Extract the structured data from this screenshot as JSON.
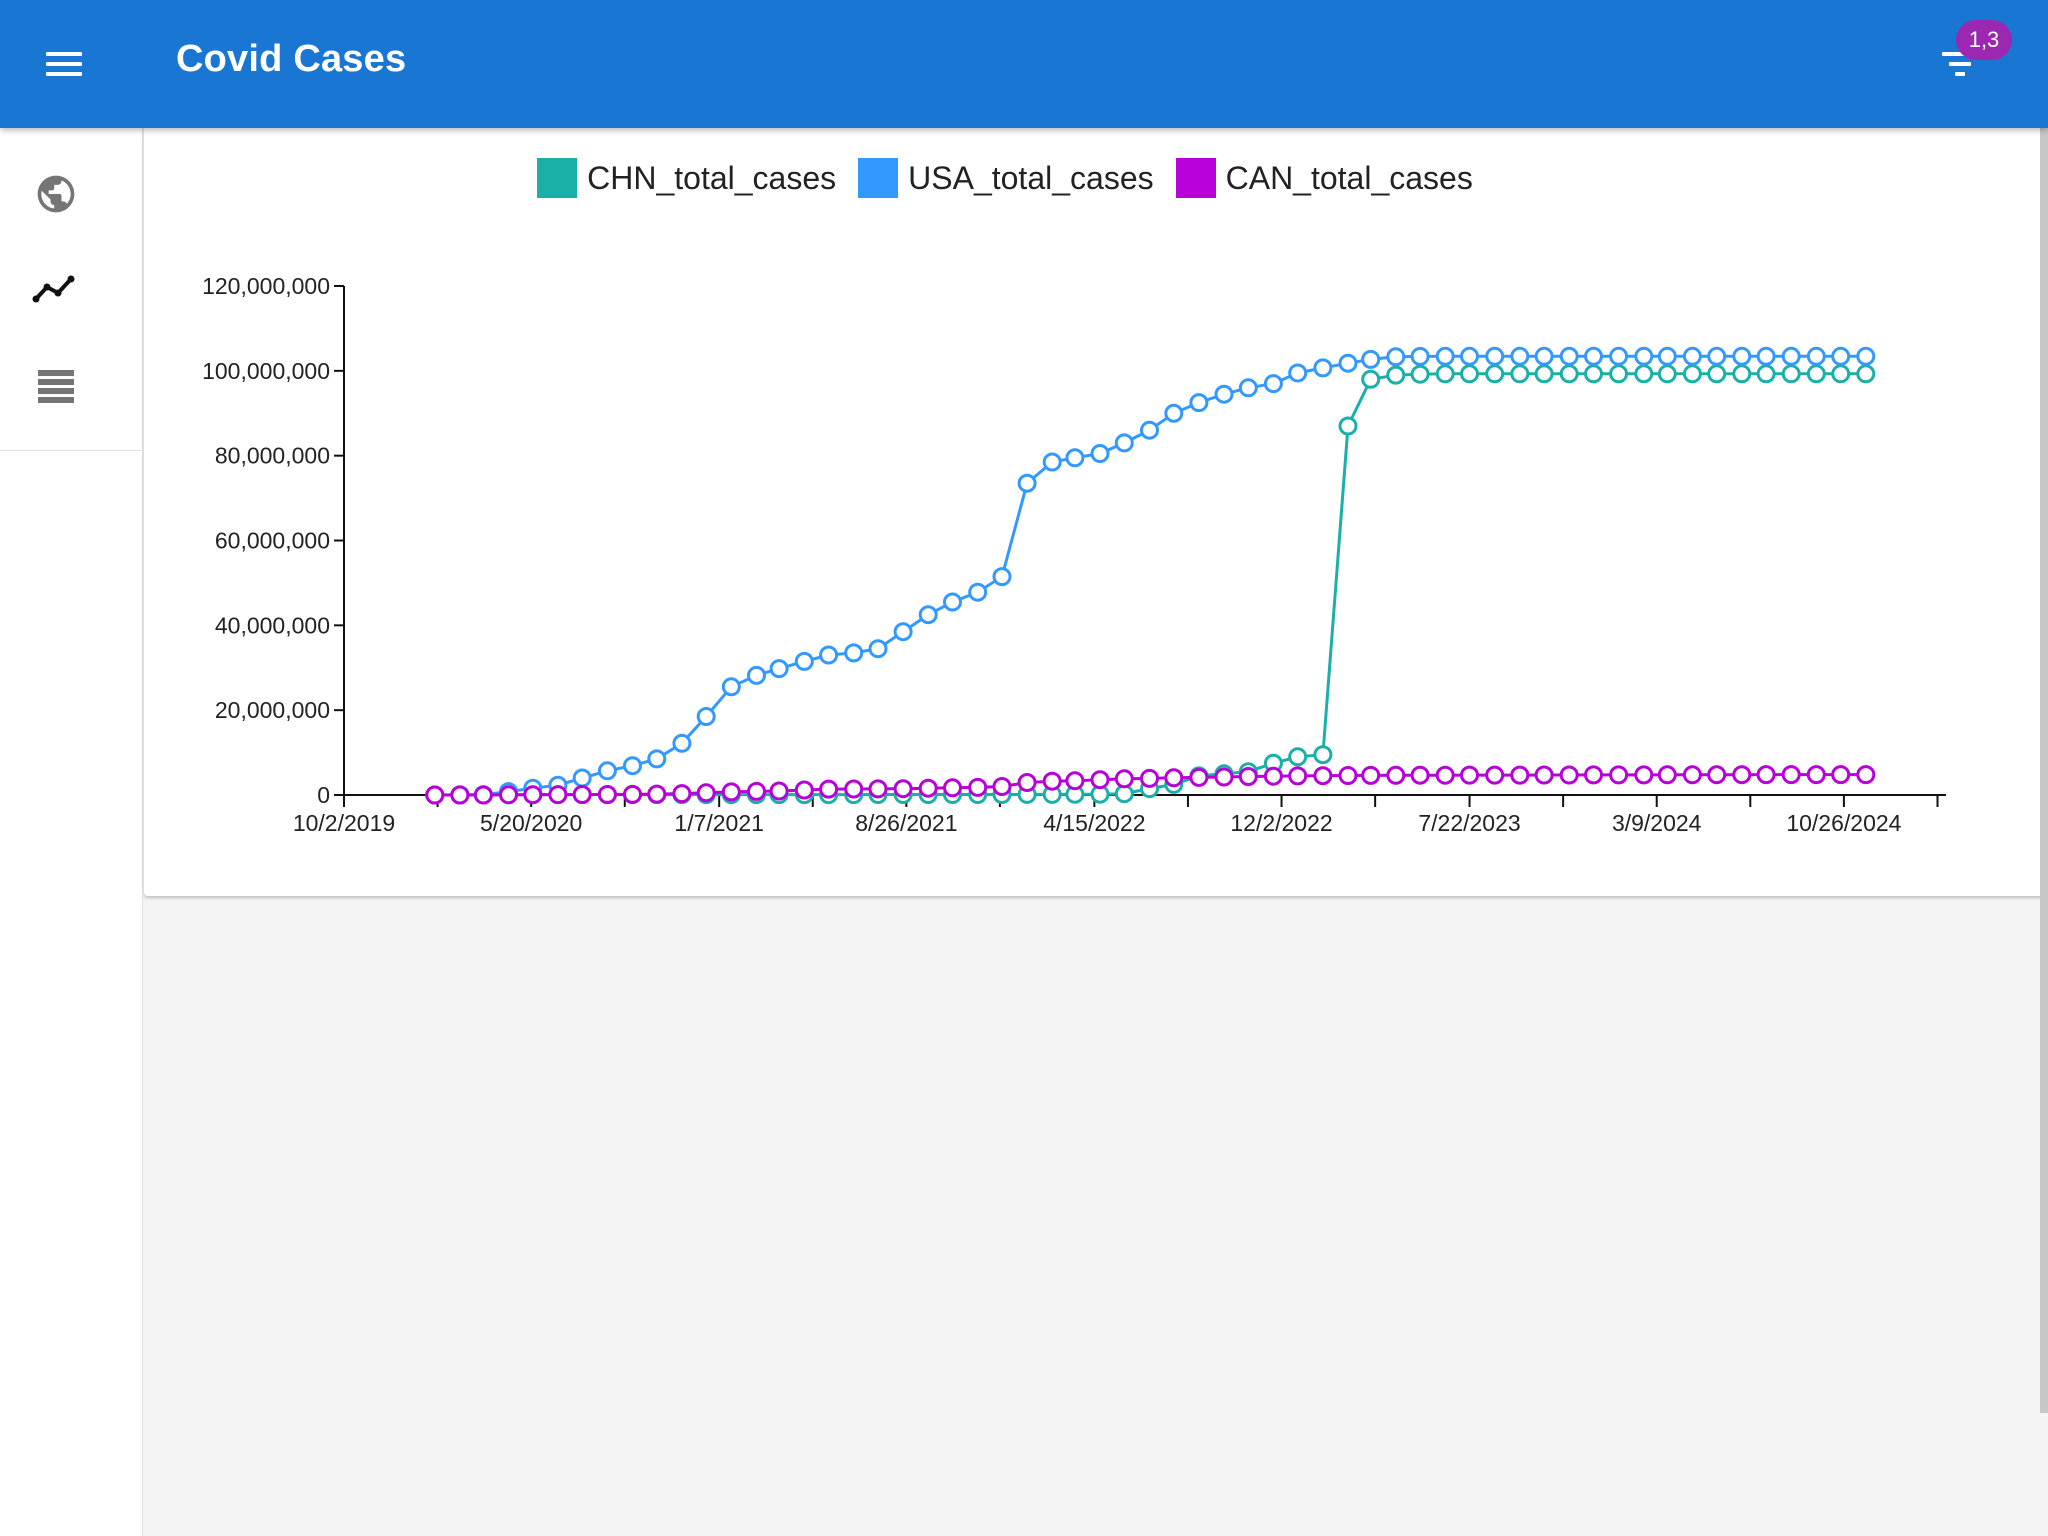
{
  "appbar": {
    "title": "Covid Cases",
    "menu_icon": "menu-icon",
    "filter_icon": "filter-icon",
    "filter_badge": "1,3",
    "color": "#1976d2",
    "badge_color": "#9c27b0"
  },
  "sidebar": {
    "items": [
      {
        "name": "globe",
        "icon": "globe-icon"
      },
      {
        "name": "chart",
        "icon": "line-chart-icon"
      },
      {
        "name": "table",
        "icon": "table-icon"
      }
    ]
  },
  "chart_data": {
    "type": "line",
    "x_type": "date",
    "x_ticks": [
      "10/2/2019",
      "5/20/2020",
      "1/7/2021",
      "8/26/2021",
      "4/15/2022",
      "12/2/2022",
      "7/22/2023",
      "3/9/2024",
      "10/26/2024"
    ],
    "x_range": [
      "2019-10-02",
      "2025-03-01"
    ],
    "y_ticks": [
      "0",
      "20,000,000",
      "40,000,000",
      "60,000,000",
      "80,000,000",
      "100,000,000",
      "120,000,000"
    ],
    "ylim": [
      0,
      120000000
    ],
    "legend_position": "top-center",
    "grid": false,
    "x": [
      "2020-01-22",
      "2020-02-22",
      "2020-03-22",
      "2020-04-22",
      "2020-05-22",
      "2020-06-22",
      "2020-07-22",
      "2020-08-22",
      "2020-09-22",
      "2020-10-22",
      "2020-11-22",
      "2020-12-22",
      "2021-01-22",
      "2021-02-22",
      "2021-03-22",
      "2021-04-22",
      "2021-05-22",
      "2021-06-22",
      "2021-07-22",
      "2021-08-22",
      "2021-09-22",
      "2021-10-22",
      "2021-11-22",
      "2021-12-22",
      "2022-01-22",
      "2022-02-22",
      "2022-03-22",
      "2022-04-22",
      "2022-05-22",
      "2022-06-22",
      "2022-07-22",
      "2022-08-22",
      "2022-09-22",
      "2022-10-22",
      "2022-11-22",
      "2022-12-22",
      "2023-01-22",
      "2023-02-22",
      "2023-03-22",
      "2023-04-22",
      "2023-05-22",
      "2023-06-22",
      "2023-07-22",
      "2023-08-22",
      "2023-09-22",
      "2023-10-22",
      "2023-11-22",
      "2023-12-22",
      "2024-01-22",
      "2024-02-22",
      "2024-03-22",
      "2024-04-22",
      "2024-05-22",
      "2024-06-22",
      "2024-07-22",
      "2024-08-22",
      "2024-09-22",
      "2024-10-22",
      "2024-11-22"
    ],
    "series": [
      {
        "name": "CHN_total_cases",
        "color": "#1ab0a8",
        "values": [
          500,
          80000,
          81000,
          82000,
          83000,
          84000,
          86000,
          89000,
          90000,
          91000,
          92000,
          95000,
          98000,
          100000,
          101000,
          102000,
          103000,
          105000,
          108000,
          110000,
          112000,
          115000,
          120000,
          125000,
          130000,
          140000,
          160000,
          200000,
          300000,
          1500000,
          2500000,
          4500000,
          5000000,
          5500000,
          7500000,
          9000000,
          9500000,
          87000000,
          98000000,
          99000000,
          99200000,
          99300000,
          99300000,
          99300000,
          99300000,
          99300000,
          99300000,
          99300000,
          99300000,
          99300000,
          99300000,
          99300000,
          99300000,
          99300000,
          99300000,
          99300000,
          99300000,
          99300000,
          99300000
        ]
      },
      {
        "name": "USA_total_cases",
        "color": "#3399ff",
        "values": [
          1,
          50,
          40000,
          800000,
          1600000,
          2300000,
          4000000,
          5700000,
          6900000,
          8500000,
          12200000,
          18500000,
          25500000,
          28200000,
          29800000,
          31500000,
          33000000,
          33500000,
          34500000,
          38500000,
          42500000,
          45500000,
          47800000,
          51500000,
          73500000,
          78500000,
          79500000,
          80500000,
          83000000,
          86000000,
          90000000,
          92500000,
          94500000,
          96000000,
          97000000,
          99500000,
          100700000,
          101800000,
          102700000,
          103300000,
          103400000,
          103436829,
          103436829,
          103436829,
          103436829,
          103436829,
          103436829,
          103436829,
          103436829,
          103436829,
          103436829,
          103436829,
          103436829,
          103436829,
          103436829,
          103436829,
          103436829,
          103436829,
          103436829
        ]
      },
      {
        "name": "CAN_total_cases",
        "color": "#b800d8",
        "values": [
          1,
          9,
          1500,
          40000,
          80000,
          100000,
          111000,
          124000,
          150000,
          210000,
          330000,
          525000,
          740000,
          850000,
          940000,
          1180000,
          1380000,
          1410000,
          1430000,
          1480000,
          1600000,
          1700000,
          1780000,
          2000000,
          2950000,
          3250000,
          3380000,
          3600000,
          3830000,
          3920000,
          4050000,
          4150000,
          4250000,
          4350000,
          4440000,
          4510000,
          4560000,
          4600000,
          4620000,
          4640000,
          4660000,
          4670000,
          4680000,
          4690000,
          4700000,
          4710000,
          4720000,
          4730000,
          4740000,
          4750000,
          4760000,
          4770000,
          4780000,
          4790000,
          4800000,
          4810000,
          4815000,
          4818000,
          4819000
        ]
      }
    ]
  }
}
